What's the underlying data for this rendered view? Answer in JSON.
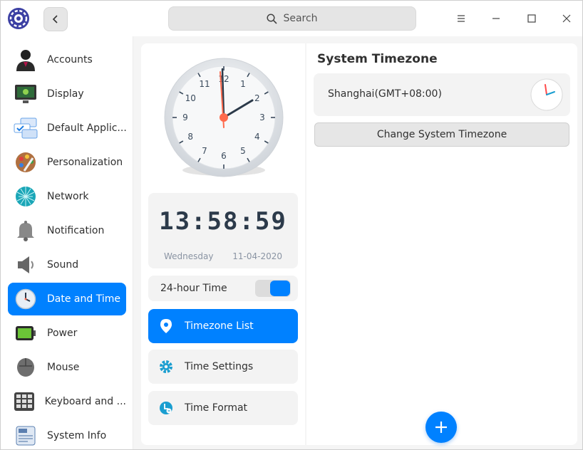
{
  "titlebar": {
    "search_label": "Search",
    "icons": {
      "logo": "control-center-logo",
      "back": "chevron-left-icon",
      "search": "search-icon",
      "menu": "hamburger-menu-icon",
      "minimize": "minimize-icon",
      "maximize": "maximize-icon",
      "close": "close-icon"
    }
  },
  "sidebar": {
    "items": [
      {
        "label": "Accounts",
        "icon": "accounts-icon"
      },
      {
        "label": "Display",
        "icon": "display-icon"
      },
      {
        "label": "Default Applic...",
        "icon": "default-applications-icon"
      },
      {
        "label": "Personalization",
        "icon": "personalization-icon"
      },
      {
        "label": "Network",
        "icon": "network-icon"
      },
      {
        "label": "Notification",
        "icon": "notification-icon"
      },
      {
        "label": "Sound",
        "icon": "sound-icon"
      },
      {
        "label": "Date and Time",
        "icon": "date-time-icon",
        "active": true
      },
      {
        "label": "Power",
        "icon": "power-icon"
      },
      {
        "label": "Mouse",
        "icon": "mouse-icon"
      },
      {
        "label": "Keyboard and ...",
        "icon": "keyboard-icon"
      },
      {
        "label": "System Info",
        "icon": "system-info-icon"
      }
    ]
  },
  "clock": {
    "analog_numbers": [
      "12",
      "1",
      "2",
      "3",
      "4",
      "5",
      "6",
      "7",
      "8",
      "9",
      "10",
      "11"
    ],
    "digital_time": "13:58:59",
    "day": "Wednesday",
    "date": "11-04-2020"
  },
  "settings": {
    "hour24_label": "24-hour Time",
    "hour24_enabled": true,
    "menu": [
      {
        "label": "Timezone List",
        "icon": "location-pin-icon",
        "active": true
      },
      {
        "label": "Time Settings",
        "icon": "gear-icon"
      },
      {
        "label": "Time Format",
        "icon": "time-format-icon"
      }
    ]
  },
  "timezone": {
    "title": "System Timezone",
    "current": "Shanghai(GMT+08:00)",
    "change_label": "Change System Timezone",
    "add_icon": "plus-icon"
  },
  "colors": {
    "accent": "#0081ff",
    "second_hand": "#ff6a4d",
    "panel": "#f3f3f3"
  }
}
